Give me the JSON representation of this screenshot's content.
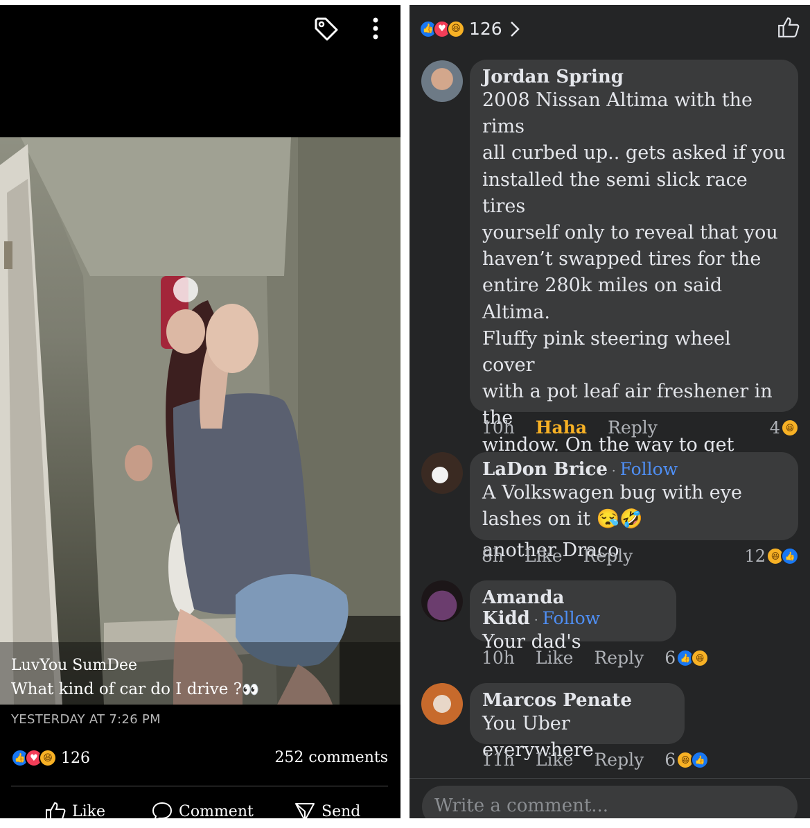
{
  "post": {
    "poster_name": "LuvYou SumDee",
    "caption": "What kind of car do I drive ?",
    "caption_emoji": "👀",
    "timestamp": "YESTERDAY AT 7:26 PM",
    "reaction_count": "126",
    "comments_count": "252 comments",
    "actions": {
      "like": "Like",
      "comment": "Comment",
      "send": "Send"
    }
  },
  "comments_panel": {
    "reaction_count": "126",
    "comments": [
      {
        "name": "Jordan Spring",
        "text": "2008 Nissan Altima with the rims\nall curbed up.. gets asked if you\ninstalled the semi slick race tires\nyourself only to reveal that you\nhaven’t swapped tires for the\nentire 280k miles on said Altima.\nFluffy pink steering wheel cover\nwith a pot leaf air freshener in the\nwindow. On the way to get check\nif ya BD sent them support\npayments yet or spent it on\nanother Draco",
        "time": "10h",
        "reaction_label": "Haha",
        "reply": "Reply",
        "react_count": "4"
      },
      {
        "name": "LaDon Brice",
        "follow": "Follow",
        "text": "A Volkswagen bug with eye\nlashes on it 😪🤣",
        "time": "8h",
        "reaction_label": "Like",
        "reply": "Reply",
        "react_count": "12"
      },
      {
        "name": "Amanda Kidd",
        "follow": "Follow",
        "text": "Your dad's",
        "time": "10h",
        "reaction_label": "Like",
        "reply": "Reply",
        "react_count": "6"
      },
      {
        "name": "Marcos Penate",
        "text": "You Uber everywhere",
        "time": "11h",
        "reaction_label": "Like",
        "reply": "Reply",
        "react_count": "6"
      }
    ],
    "write_placeholder": "Write a comment..."
  },
  "colors": {
    "like_blue": "#1877f2",
    "love_red": "#f33e58",
    "haha_yellow": "#f7b125",
    "follow_blue": "#4f8ff5",
    "panel_bg": "#242526",
    "bubble_bg": "#3a3b3c"
  },
  "icons": [
    "tag-icon",
    "more-vertical-icon",
    "thumbs-up-icon",
    "comment-icon",
    "send-icon",
    "chevron-right-icon"
  ]
}
